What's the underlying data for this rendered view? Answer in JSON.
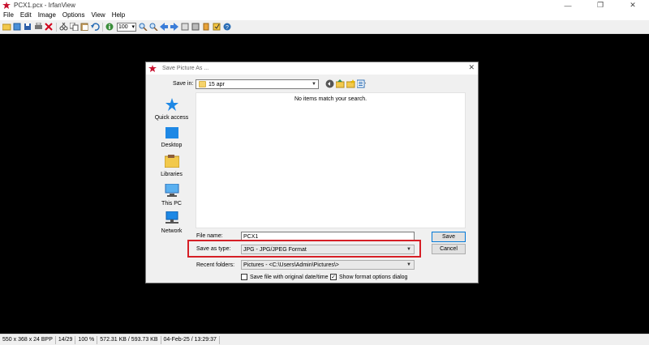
{
  "window": {
    "title": "PCX1.pcx - IrfanView",
    "minimize_glyph": "—",
    "maximize_glyph": "❐",
    "close_glyph": "✕"
  },
  "menu": [
    "File",
    "Edit",
    "Image",
    "Options",
    "View",
    "Help"
  ],
  "toolbar": {
    "zoom_value": "100",
    "icons": [
      "open-icon",
      "reopen-icon",
      "save-icon",
      "print-icon",
      "delete-icon",
      "cut-icon",
      "copy-icon",
      "paste-icon",
      "undo-icon",
      "info-icon",
      "zoom-in-icon",
      "zoom-out-icon",
      "previous-icon",
      "next-icon",
      "slideshow-icon",
      "gallery-icon",
      "paint-icon",
      "options-icon",
      "help-icon"
    ]
  },
  "statusbar": {
    "cells": [
      "550 x 368 x 24 BPP",
      "14/29",
      "100 %",
      "572.31 KB / 593.73 KB",
      "04-Feb-25 / 13:29:37"
    ]
  },
  "dialog": {
    "title": "Save Picture As ...",
    "close_glyph": "✕",
    "save_in_label": "Save in:",
    "save_in_value": "15 apr",
    "empty_message": "No items match your search.",
    "places": [
      {
        "label": "Quick access",
        "icon": "quick-access-icon"
      },
      {
        "label": "Desktop",
        "icon": "desktop-icon"
      },
      {
        "label": "Libraries",
        "icon": "libraries-icon"
      },
      {
        "label": "This PC",
        "icon": "this-pc-icon"
      },
      {
        "label": "Network",
        "icon": "network-icon"
      }
    ],
    "file_name_label": "File name:",
    "file_name_value": "PCX1",
    "save_as_type_label": "Save as type:",
    "save_as_type_value": "JPG - JPG/JPEG Format",
    "recent_folders_label": "Recent folders:",
    "recent_folders_value": "Pictures  -  <C:\\Users\\Admin\\Pictures\\>",
    "save_button": "Save",
    "cancel_button": "Cancel",
    "checkbox_original_date": {
      "label": "Save file with original date/time",
      "checked": false
    },
    "checkbox_format_options": {
      "label": "Show format options dialog",
      "checked": true
    },
    "highlight_color": "#d61f26"
  }
}
